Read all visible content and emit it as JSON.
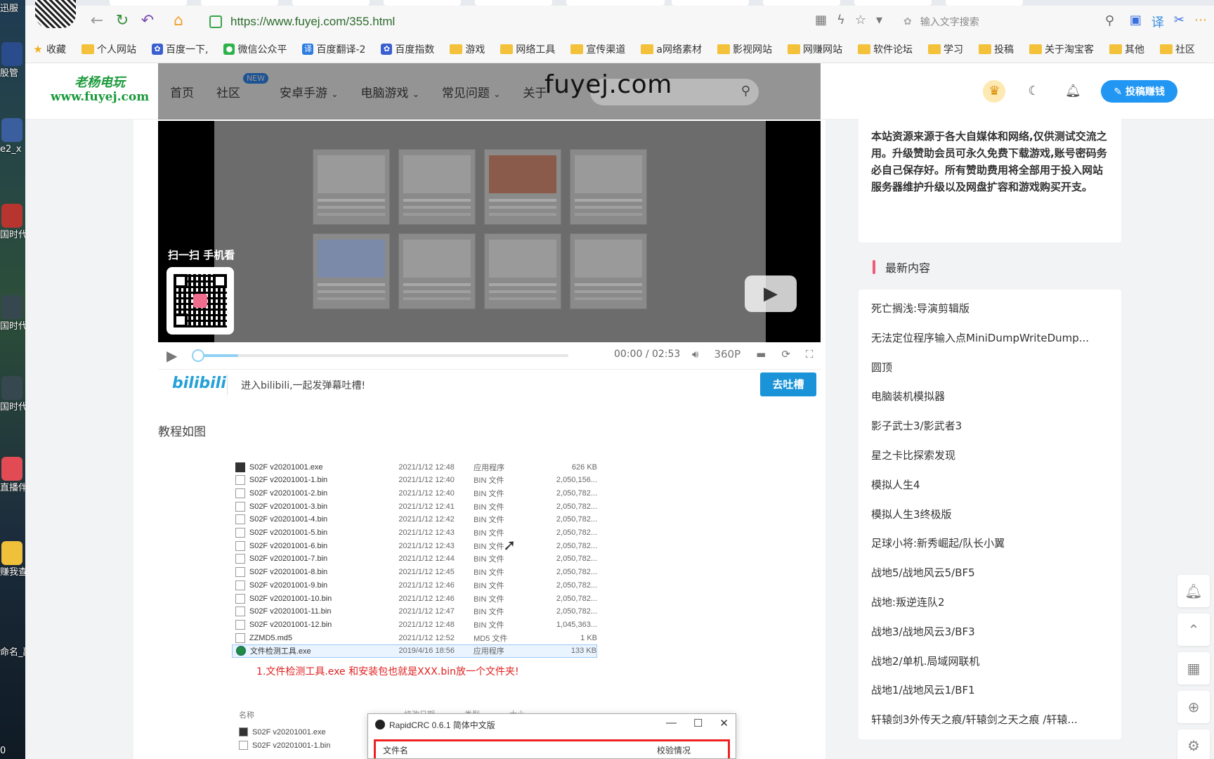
{
  "desktop": {
    "icons": [
      "迅服",
      "股管",
      "e2_x",
      "国时代 中文版",
      "国时代 复兴篇",
      "国时代 复兴旗",
      "直播伴",
      "赚我查",
      "命名_副本.j",
      "0"
    ]
  },
  "browser": {
    "url": "https://www.fuyej.com/355.html",
    "search_placeholder": "输入文字搜索",
    "bookmarks": [
      "收藏",
      "个人网站",
      "百度一下,",
      "微信公众平",
      "百度翻译-2",
      "百度指数",
      "游戏",
      "网络工具",
      "宣传渠道",
      "a网络素材",
      "影视网站",
      "网赚网站",
      "软件论坛",
      "学习",
      "投稿",
      "关于淘宝客",
      "其他",
      "社区"
    ]
  },
  "site": {
    "logo_line1": "老杨电玩",
    "logo_line2": "www.fuyej.com",
    "nav": [
      "首页",
      "社区",
      "安卓手游",
      "电脑游戏",
      "常见问题",
      "关于"
    ],
    "nav_badge": "NEW",
    "watermark": "fuyej.com",
    "submit_label": "投稿赚钱"
  },
  "player": {
    "scan_label": "扫一扫 手机看",
    "time_current": "00:00",
    "time_sep": "/",
    "time_total": "02:53",
    "quality": "360P",
    "bili_logo": "bilibili",
    "danmaku_prompt": "进入bilibili,一起发弹幕吐槽!",
    "danmaku_button": "去吐槽"
  },
  "article": {
    "section_title": "教程如图",
    "files": [
      {
        "name": "S02F v20201001.exe",
        "date": "2021/1/12 12:48",
        "type": "应用程序",
        "size": "626 KB",
        "kind": "exe"
      },
      {
        "name": "S02F v20201001-1.bin",
        "date": "2021/1/12 12:40",
        "type": "BIN 文件",
        "size": "2,050,156...",
        "kind": "bin"
      },
      {
        "name": "S02F v20201001-2.bin",
        "date": "2021/1/12 12:40",
        "type": "BIN 文件",
        "size": "2,050,782...",
        "kind": "bin"
      },
      {
        "name": "S02F v20201001-3.bin",
        "date": "2021/1/12 12:41",
        "type": "BIN 文件",
        "size": "2,050,782...",
        "kind": "bin"
      },
      {
        "name": "S02F v20201001-4.bin",
        "date": "2021/1/12 12:42",
        "type": "BIN 文件",
        "size": "2,050,782...",
        "kind": "bin"
      },
      {
        "name": "S02F v20201001-5.bin",
        "date": "2021/1/12 12:43",
        "type": "BIN 文件",
        "size": "2,050,782...",
        "kind": "bin"
      },
      {
        "name": "S02F v20201001-6.bin",
        "date": "2021/1/12 12:43",
        "type": "BIN 文件",
        "size": "2,050,782...",
        "kind": "bin"
      },
      {
        "name": "S02F v20201001-7.bin",
        "date": "2021/1/12 12:44",
        "type": "BIN 文件",
        "size": "2,050,782...",
        "kind": "bin"
      },
      {
        "name": "S02F v20201001-8.bin",
        "date": "2021/1/12 12:45",
        "type": "BIN 文件",
        "size": "2,050,782...",
        "kind": "bin"
      },
      {
        "name": "S02F v20201001-9.bin",
        "date": "2021/1/12 12:46",
        "type": "BIN 文件",
        "size": "2,050,782...",
        "kind": "bin"
      },
      {
        "name": "S02F v20201001-10.bin",
        "date": "2021/1/12 12:46",
        "type": "BIN 文件",
        "size": "2,050,782...",
        "kind": "bin"
      },
      {
        "name": "S02F v20201001-11.bin",
        "date": "2021/1/12 12:47",
        "type": "BIN 文件",
        "size": "2,050,782...",
        "kind": "bin"
      },
      {
        "name": "S02F v20201001-12.bin",
        "date": "2021/1/12 12:48",
        "type": "BIN 文件",
        "size": "1,045,363...",
        "kind": "bin"
      },
      {
        "name": "ZZMD5.md5",
        "date": "2021/1/12 12:52",
        "type": "MD5 文件",
        "size": "1 KB",
        "kind": "bin"
      },
      {
        "name": "文件检测工具.exe",
        "date": "2019/4/16 18:56",
        "type": "应用程序",
        "size": "133 KB",
        "kind": "tool"
      }
    ],
    "file_note": "1.文件检测工具.exe 和安装包也就是XXX.bin放一个文件夹!",
    "explorer2": {
      "col_name": "名称",
      "col_date": "修改日期",
      "col_type": "类型",
      "col_size": "大小",
      "rows": [
        "S02F v20201001.exe",
        "S02F v20201001-1.bin"
      ]
    },
    "rapidcrc": {
      "title": "RapidCRC 0.6.1 简体中文版",
      "col_filename": "文件名",
      "col_check": "校验情况"
    }
  },
  "sidebar": {
    "notice": "本站资源来源于各大自媒体和网络,仅供测试交流之用。升级赞助会员可永久免费下载游戏,账号密码务必自己保存好。所有赞助费用将全部用于投入网站服务器维护升级以及网盘扩容和游戏购买开支。",
    "latest_title": "最新内容",
    "latest": [
      "死亡搁浅:导演剪辑版",
      "无法定位程序输入点MiniDumpWriteDump...",
      "圆顶",
      "电脑装机模拟器",
      "影子武士3/影武者3",
      "星之卡比探索发现",
      "模拟人生4",
      "模拟人生3终极版",
      "足球小将:新秀崛起/队长小翼",
      "战地5/战地风云5/BF5",
      "战地:叛逆连队2",
      "战地3/战地风云3/BF3",
      "战地2/单机.局域网联机",
      "战地1/战地风云1/BF1",
      "轩辕剑3外传天之痕/轩辕剑之天之痕 /轩辕..."
    ]
  }
}
